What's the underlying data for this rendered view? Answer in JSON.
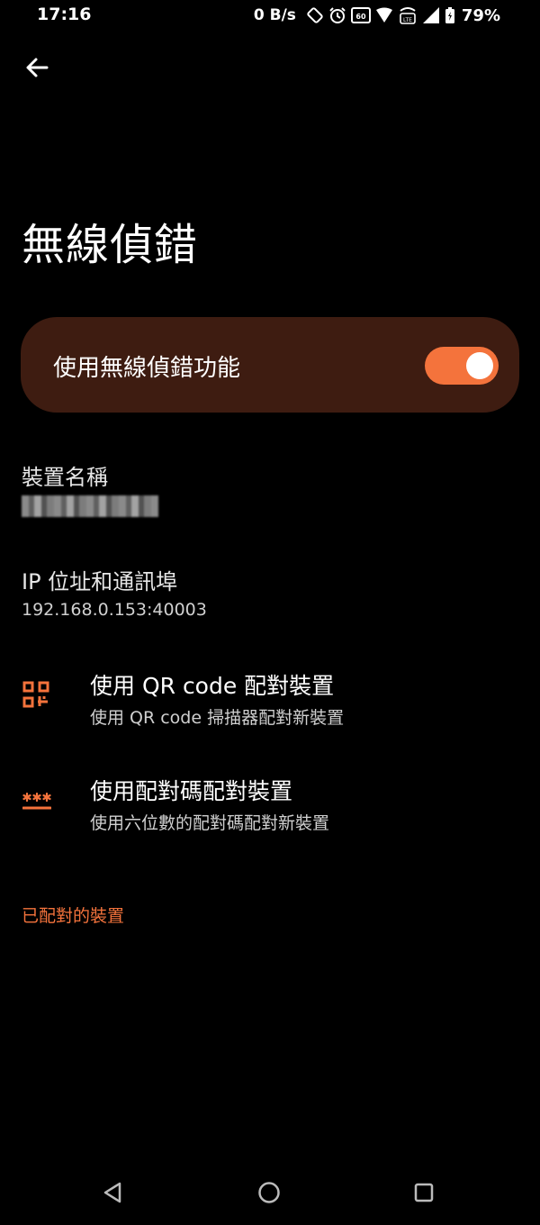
{
  "status_bar": {
    "time": "17:16",
    "net_speed": "0 B/s",
    "battery": "79%"
  },
  "page": {
    "title": "無線偵錯"
  },
  "main_toggle": {
    "label": "使用無線偵錯功能",
    "on": true
  },
  "device_name": {
    "title": "裝置名稱"
  },
  "ip_port": {
    "title": "IP 位址和通訊埠",
    "value": "192.168.0.153:40003"
  },
  "pair_qr": {
    "title": "使用 QR code 配對裝置",
    "subtitle": "使用 QR code 掃描器配對新裝置"
  },
  "pair_code": {
    "title": "使用配對碼配對裝置",
    "subtitle": "使用六位數的配對碼配對新裝置"
  },
  "paired_devices": {
    "header": "已配對的裝置"
  },
  "colors": {
    "accent": "#f4733c",
    "card_background": "#3e1c11",
    "background": "#000000"
  }
}
